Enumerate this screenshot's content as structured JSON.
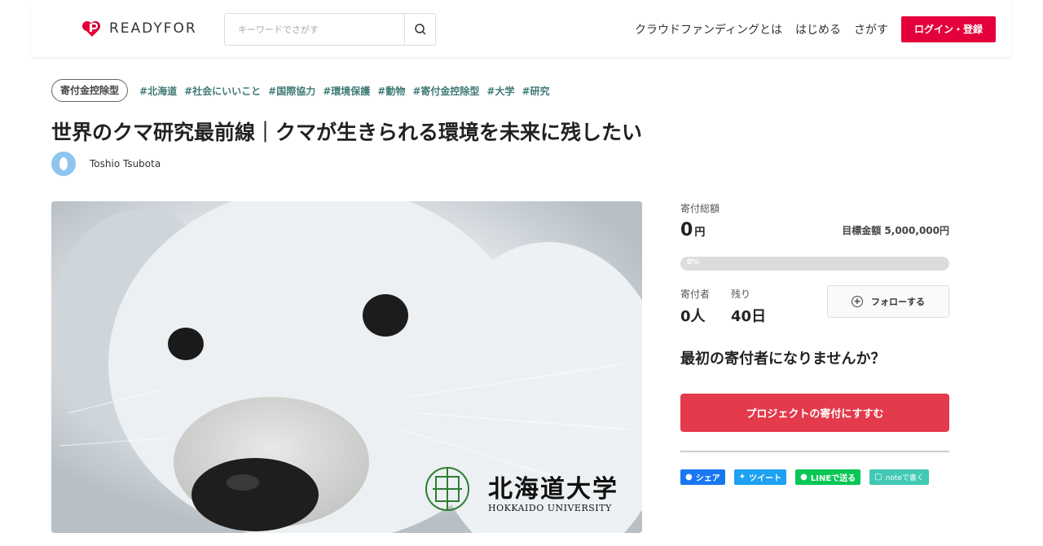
{
  "header": {
    "logo_text": "READYFOR",
    "search_placeholder": "キーワードでさがす",
    "nav": [
      "クラウドファンディングとは",
      "はじめる",
      "さがす"
    ],
    "login_label": "ログイン・登録",
    "brand_color": "#e4003a"
  },
  "project": {
    "category_pill": "寄付金控除型",
    "tags": [
      "#北海道",
      "#社会にいいこと",
      "#国際協力",
      "#環境保護",
      "#動物",
      "#寄付金控除型",
      "#大学",
      "#研究"
    ],
    "title": "世界のクマ研究最前線｜クマが生きられる環境を未来に残したい",
    "author": "Toshio Tsubota",
    "image_caption_jp": "北海道大学",
    "image_caption_en": "HOKKAIDO UNIVERSITY"
  },
  "panel": {
    "total_label": "寄付総額",
    "total_value": "0",
    "total_unit": "円",
    "goal_text": "目標金額 5,000,000円",
    "progress_text": "0%",
    "progress_fraction": 0,
    "donors_label": "寄付者",
    "donors_value": "0人",
    "remaining_label": "残り",
    "remaining_value": "40日",
    "follow_label": "フォローする",
    "cta_question": "最初の寄付者になりませんか？",
    "cta_button": "プロジェクトの寄付にすすむ",
    "accent_color": "#e33a4c"
  },
  "share": {
    "facebook": "シェア",
    "twitter": "ツイート",
    "line": "LINEで送る",
    "note": "noteで書く"
  }
}
